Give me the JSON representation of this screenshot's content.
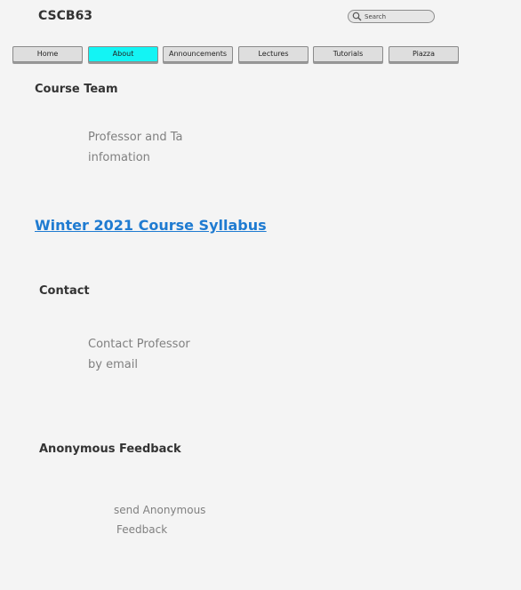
{
  "header": {
    "site_title": "CSCB63",
    "search_placeholder": "Search"
  },
  "nav": {
    "items": [
      {
        "label": "Home",
        "active": false
      },
      {
        "label": "About",
        "active": true
      },
      {
        "label": "Announcements",
        "active": false
      },
      {
        "label": "Lectures",
        "active": false
      },
      {
        "label": "Tutorials",
        "active": false
      },
      {
        "label": "Piazza",
        "active": false
      }
    ]
  },
  "colors": {
    "active_tab": "#13f4f4",
    "link": "#1f7bd1",
    "background": "#f4f4f4"
  },
  "sections": {
    "course_team": {
      "heading": "Course Team",
      "text_line1": "Professor and Ta",
      "text_line2": "infomation"
    },
    "syllabus": {
      "link_text": "Winter 2021 Course Syllabus"
    },
    "contact": {
      "heading": "Contact",
      "text_line1": "Contact Professor",
      "text_line2": "by email"
    },
    "feedback": {
      "heading": "Anonymous Feedback",
      "text_line1": "send Anonymous",
      "text_line2": "Feedback"
    }
  }
}
